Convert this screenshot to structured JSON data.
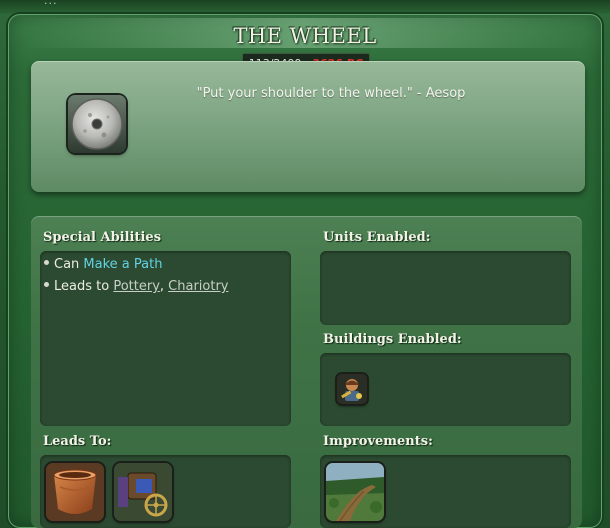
{
  "top_strip": {
    "text": "..."
  },
  "header": {
    "title": "THE WHEEL",
    "progress": "113/2400",
    "separator": " - ",
    "date": "3626 BC"
  },
  "quote": {
    "text": "\"Put your shoulder to the wheel.\" - Aesop",
    "icon": "stone-wheel-icon"
  },
  "sections": {
    "special_abilities": {
      "header": "Special Abilities",
      "items": [
        {
          "prefix": "Can ",
          "link": "Make a Path"
        },
        {
          "prefix": "Leads to ",
          "links": [
            "Pottery",
            "Chariotry"
          ],
          "link_separator": ", "
        }
      ]
    },
    "units_enabled": {
      "header": "Units Enabled:"
    },
    "buildings_enabled": {
      "header": "Buildings Enabled:",
      "items": [
        "worker-building-icon"
      ]
    },
    "leads_to": {
      "header": "Leads To:",
      "items": [
        "pottery-icon",
        "chariotry-icon"
      ]
    },
    "improvements": {
      "header": "Improvements:",
      "items": [
        "path-improvement-icon"
      ]
    }
  },
  "colors": {
    "date_red": "#e8322a",
    "link_cyan": "#62d2e2",
    "panel_green": "#3f7346"
  }
}
